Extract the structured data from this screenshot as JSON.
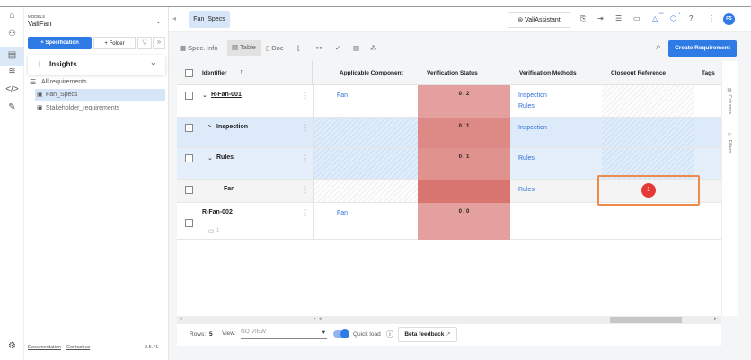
{
  "models_label": "MODELS",
  "model_name": "ValiFan",
  "sidebar": {
    "spec_button": "+ Specification",
    "folder_button": "+ Folder",
    "insights": "Insights",
    "all_requirements": "All requirements",
    "items": [
      "Fan_Specs",
      "Stakeholder_requirements"
    ],
    "documentation": "Documentation",
    "contact": "Contact us",
    "version": "2.5.41"
  },
  "tab": "Fan_Specs",
  "header": {
    "assistant": "ValiAssistant",
    "notif_count": "28",
    "tasks_count": "1",
    "avatar": "FS"
  },
  "toolbar": {
    "spec_info": "Spec. info",
    "table": "Table",
    "doc": "Doc",
    "create": "Create Requirement"
  },
  "columns": [
    "Identifier",
    "Applicable Component",
    "Verification Status",
    "Verification Methods",
    "Closeout Reference",
    "Tags"
  ],
  "side_tabs": {
    "columns": "Columns",
    "filters": "Filters"
  },
  "rows": [
    {
      "id": "R-Fan-001",
      "component": "Fan",
      "status": "0 / 2",
      "methods": [
        "Inspection",
        "Rules"
      ]
    },
    {
      "id": "Inspection",
      "status": "0 / 1",
      "methods": [
        "Inspection"
      ]
    },
    {
      "id": "Rules",
      "status": "0 / 1",
      "methods": [
        "Rules"
      ]
    },
    {
      "id": "Fan",
      "methods": [
        "Rules"
      ]
    },
    {
      "id": "R-Fan-002",
      "component": "Fan",
      "status": "0 / 0",
      "comments": "1"
    }
  ],
  "annotation": "1",
  "footer": {
    "rows_label": "Rows:",
    "rows_value": "5",
    "view_label": "View:",
    "view_value": "NO VIEW",
    "quick_load": "Quick load",
    "beta": "Beta feedback"
  },
  "colors": {
    "accent": "#2f7be6",
    "status_red": "#e39c9a",
    "highlight": "#f08a4b"
  }
}
